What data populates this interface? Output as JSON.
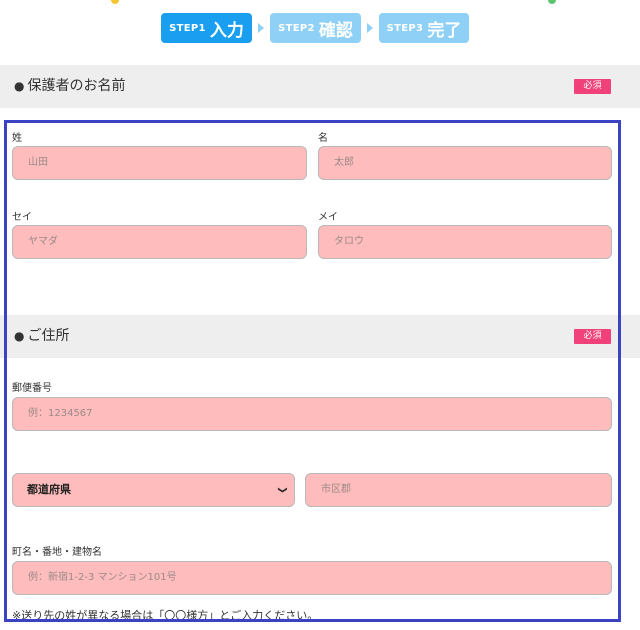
{
  "steps": [
    {
      "num": "STEP1",
      "label": "入力",
      "active": true
    },
    {
      "num": "STEP2",
      "label": "確認",
      "active": false
    },
    {
      "num": "STEP3",
      "label": "完了",
      "active": false
    }
  ],
  "guardian_section": {
    "title": "保護者のお名前",
    "required": "必須"
  },
  "name_fields": {
    "last_name": {
      "label": "姓",
      "placeholder": "山田"
    },
    "first_name": {
      "label": "名",
      "placeholder": "太郎"
    },
    "last_name_kana": {
      "label": "セイ",
      "placeholder": "ヤマダ"
    },
    "first_name_kana": {
      "label": "メイ",
      "placeholder": "タロウ"
    }
  },
  "address_section": {
    "title": "ご住所",
    "required": "必須"
  },
  "address_fields": {
    "postal": {
      "label": "郵便番号",
      "placeholder": "例：1234567"
    },
    "prefecture": {
      "selected": "都道府県"
    },
    "city": {
      "placeholder": "市区郡"
    },
    "street": {
      "label": "町名・番地・建物名",
      "placeholder": "例：新宿1-2-3 マンション101号"
    }
  },
  "note": "※送り先の姓が異なる場合は「〇〇様方」とご入力ください。",
  "colors": {
    "step_active": "#1a9ff0",
    "step_inactive": "#8fd0f7",
    "badge": "#f0417a",
    "field_bg": "#ffbcbc",
    "frame": "#3b43c4"
  }
}
